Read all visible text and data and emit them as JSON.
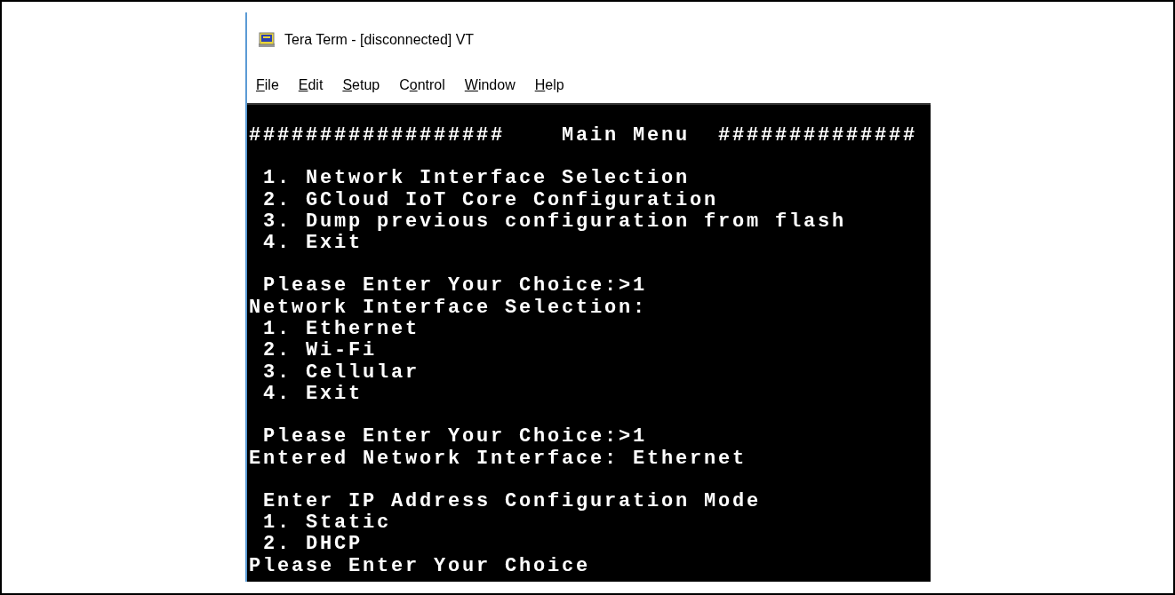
{
  "window": {
    "title": "Tera Term - [disconnected] VT"
  },
  "menu": [
    {
      "key": "F",
      "after": "ile"
    },
    {
      "key": "E",
      "after": "dit"
    },
    {
      "key": "S",
      "after": "etup"
    },
    {
      "before": "C",
      "key": "o",
      "after": "ntrol"
    },
    {
      "key": "W",
      "after": "indow"
    },
    {
      "key": "H",
      "after": "elp"
    }
  ],
  "terminal": {
    "blocks": [
      [
        "##################    Main Menu  ##############"
      ],
      [
        " 1. Network Interface Selection",
        " 2. GCloud IoT Core Configuration",
        " 3. Dump previous configuration from flash",
        " 4. Exit"
      ],
      [
        " Please Enter Your Choice:>1",
        "Network Interface Selection:",
        " 1. Ethernet",
        " 2. Wi-Fi",
        " 3. Cellular",
        " 4. Exit"
      ],
      [
        " Please Enter Your Choice:>1",
        "Entered Network Interface: Ethernet"
      ],
      [
        " Enter IP Address Configuration Mode",
        " 1. Static",
        " 2. DHCP",
        "Please Enter Your Choice"
      ]
    ]
  }
}
